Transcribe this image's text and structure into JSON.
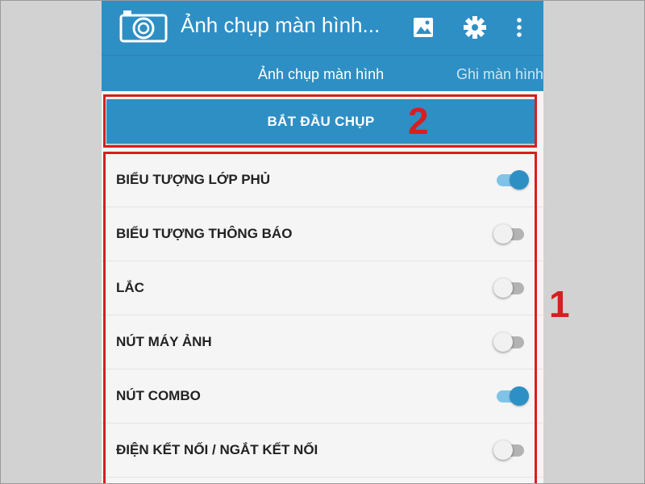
{
  "app_bar": {
    "title": "Ảnh chụp màn hình...",
    "logo_icon": "camera-icon",
    "actions": [
      "gallery-icon",
      "settings-icon",
      "more-vert-icon"
    ],
    "color": "#2e8fc4"
  },
  "tabs": [
    {
      "label": "Ảnh chụp màn hình",
      "selected": true
    },
    {
      "label": "Ghi màn hình",
      "selected": false
    }
  ],
  "start_button": {
    "label": "BẮT ĐẦU CHỤP"
  },
  "settings": [
    {
      "label": "BIỂU TƯỢNG LỚP PHỦ",
      "on": true
    },
    {
      "label": "BIỂU TƯỢNG THÔNG BÁO",
      "on": false
    },
    {
      "label": "LẮC",
      "on": false
    },
    {
      "label": "NÚT MÁY ẢNH",
      "on": false
    },
    {
      "label": "NÚT COMBO",
      "on": true
    },
    {
      "label": "ĐIỆN KẾT NỐI / NGẮT KẾT NỐI",
      "on": false
    }
  ],
  "annotations": {
    "marker_2": "2",
    "marker_1": "1",
    "color": "#d61f1f"
  }
}
